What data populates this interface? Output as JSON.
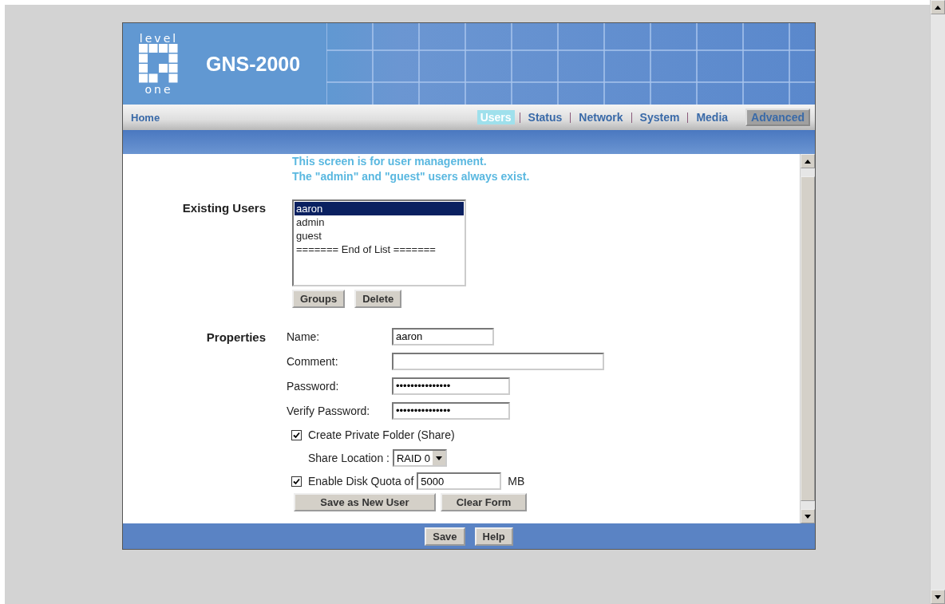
{
  "header": {
    "logo_top": "level",
    "logo_bottom": "one",
    "product": "GNS-2000"
  },
  "nav": {
    "home": "Home",
    "tabs": [
      {
        "label": "Users",
        "selected": true
      },
      {
        "label": "Status",
        "selected": false
      },
      {
        "label": "Network",
        "selected": false
      },
      {
        "label": "System",
        "selected": false
      },
      {
        "label": "Media",
        "selected": false
      }
    ],
    "advanced": "Advanced"
  },
  "intro": [
    "This screen is for user management.",
    "The \"admin\" and \"guest\" users always exist."
  ],
  "existing_users": {
    "label": "Existing Users",
    "items": [
      {
        "text": "aaron",
        "selected": true
      },
      {
        "text": "admin",
        "selected": false
      },
      {
        "text": "guest",
        "selected": false
      },
      {
        "text": "======= End of List =======",
        "selected": false
      }
    ],
    "buttons": [
      "Groups",
      "Delete"
    ]
  },
  "properties": {
    "label": "Properties",
    "fields": [
      {
        "label": "Name:",
        "value": "aaron"
      },
      {
        "label": "Comment:"
      },
      {
        "label": "Password:",
        "value": "•••••••••••••••"
      },
      {
        "label": "Verify Password:",
        "value": "•••••••••••••••"
      }
    ],
    "create_folder": {
      "label": "Create Private Folder (Share)",
      "checked": true
    },
    "share_location": {
      "label": "Share Location :",
      "value": "RAID 0"
    },
    "quota": {
      "label": "Enable Disk Quota of",
      "checked": true,
      "value": "5000",
      "unit": "MB"
    },
    "buttons": [
      "Save as New User",
      "Clear Form"
    ]
  },
  "footer_buttons": [
    "Save",
    "Help"
  ]
}
